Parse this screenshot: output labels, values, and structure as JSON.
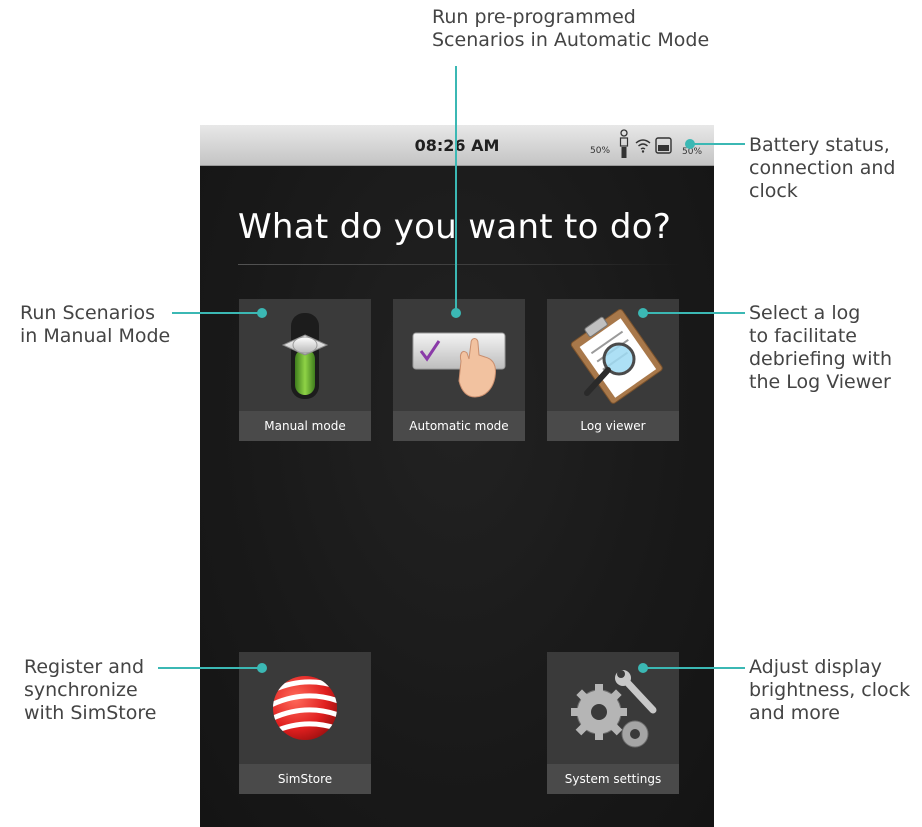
{
  "status_bar": {
    "time": "08:26 AM",
    "left_percent": "50%",
    "right_percent": "50%",
    "icons": [
      "person-battery-icon",
      "wifi-icon",
      "battery-icon"
    ]
  },
  "main": {
    "heading": "What do you want to do?"
  },
  "tiles": [
    {
      "id": "manual",
      "label": "Manual mode",
      "icon": "slider-switch-icon"
    },
    {
      "id": "automatic",
      "label": "Automatic mode",
      "icon": "checkbox-touch-icon"
    },
    {
      "id": "log",
      "label": "Log viewer",
      "icon": "clipboard-magnifier-icon"
    },
    {
      "id": "simstore",
      "label": "SimStore",
      "icon": "simstore-sphere-icon"
    },
    {
      "id": "settings",
      "label": "System settings",
      "icon": "gears-wrench-icon"
    }
  ],
  "annotations": {
    "top": [
      "Run pre-programmed",
      "Scenarios in Automatic Mode"
    ],
    "battery": [
      "Battery status,",
      "connection and",
      "clock"
    ],
    "manual": [
      "Run Scenarios",
      "in Manual Mode"
    ],
    "log": [
      "Select a log",
      "to facilitate",
      "debriefing with",
      "the Log Viewer"
    ],
    "simstore": [
      "Register and",
      "synchronize",
      "with SimStore"
    ],
    "settings": [
      "Adjust display",
      "brightness, clock",
      "and more"
    ]
  },
  "colors": {
    "callout": "#3bb8b4",
    "screen_bg": "#191919",
    "tile_bg": "#3a3a3a",
    "tile_label_bg": "#4a4a4a"
  }
}
